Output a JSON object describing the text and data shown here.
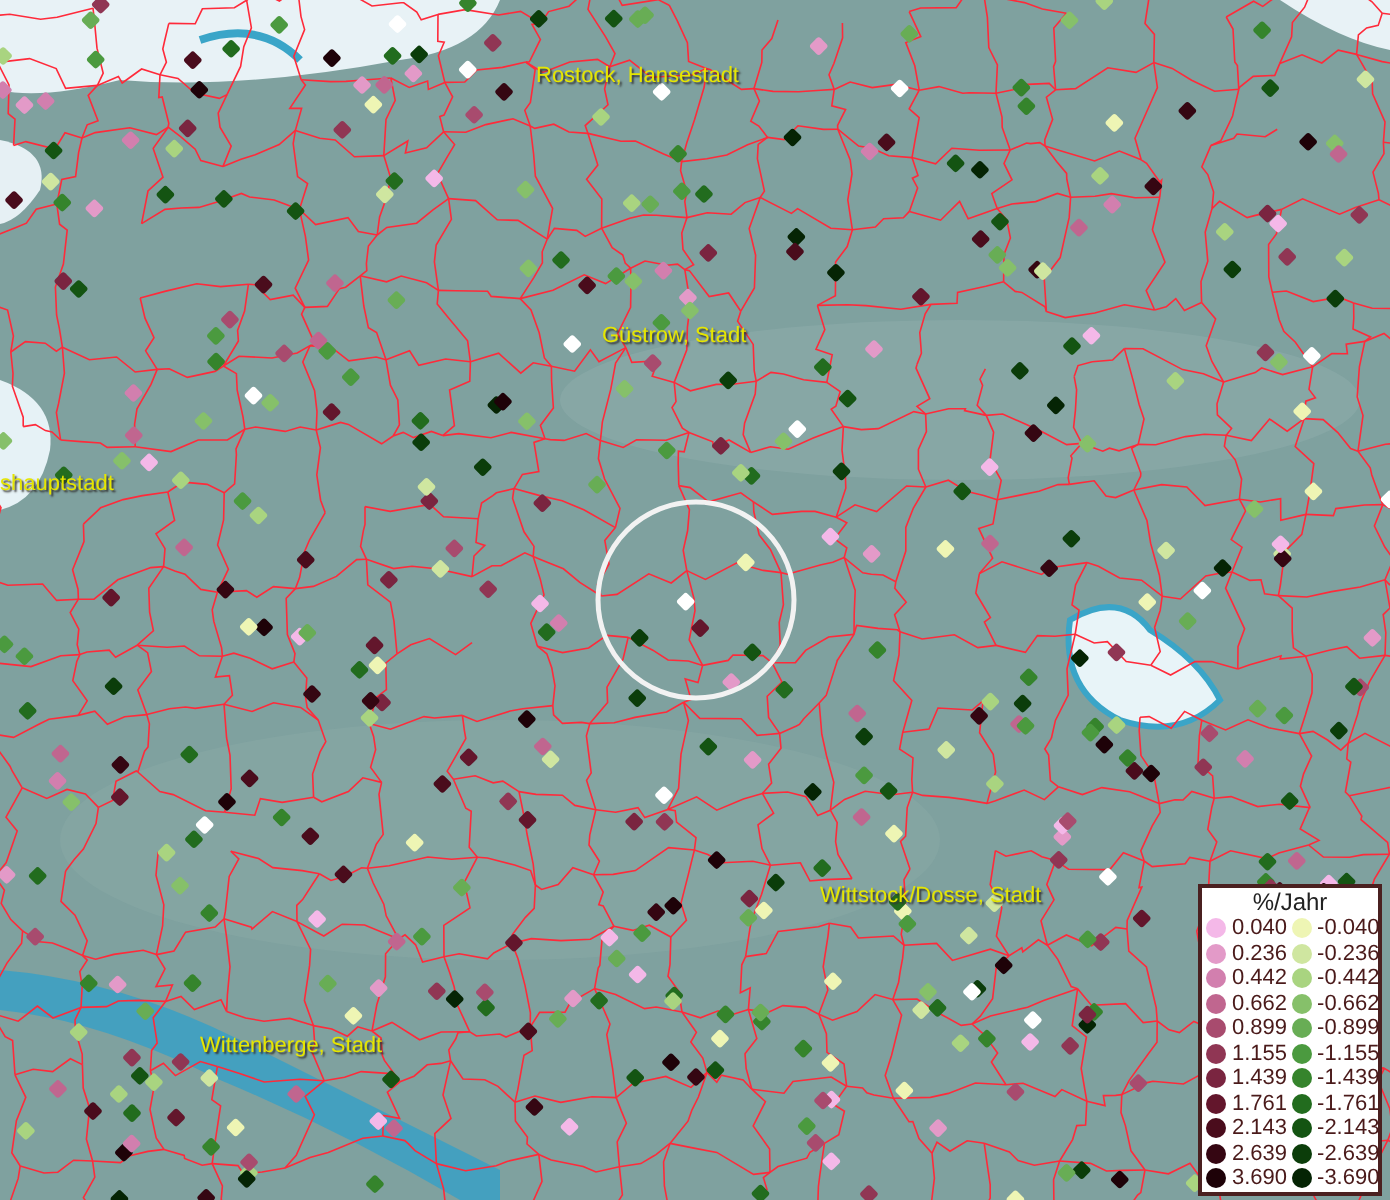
{
  "map": {
    "places": [
      {
        "name": "Rostock, Hansestadt"
      },
      {
        "name": "Güstrow, Stadt"
      },
      {
        "name": "shauptstadt"
      },
      {
        "name": "Wittstock/Dosse, Stadt"
      },
      {
        "name": "Wittenberge, Stadt"
      }
    ]
  },
  "legend": {
    "title": "%/Jahr",
    "entries": [
      {
        "label": "0.040",
        "color": "#f4b8e8"
      },
      {
        "label": "-0.040",
        "color": "#eef5b4"
      },
      {
        "label": "0.236",
        "color": "#e39ac8"
      },
      {
        "label": "-0.236",
        "color": "#cfe6a0"
      },
      {
        "label": "0.442",
        "color": "#d27fae"
      },
      {
        "label": "-0.442",
        "color": "#a9d480"
      },
      {
        "label": "0.662",
        "color": "#c0668f"
      },
      {
        "label": "-0.662",
        "color": "#86c06a"
      },
      {
        "label": "0.899",
        "color": "#a84b6e"
      },
      {
        "label": "-0.899",
        "color": "#68ad55"
      },
      {
        "label": "1.155",
        "color": "#903654"
      },
      {
        "label": "-1.155",
        "color": "#4b9a3f"
      },
      {
        "label": "1.439",
        "color": "#7a2540"
      },
      {
        "label": "-1.439",
        "color": "#35842c"
      },
      {
        "label": "1.761",
        "color": "#63162c"
      },
      {
        "label": "-1.761",
        "color": "#226c1e"
      },
      {
        "label": "2.143",
        "color": "#4a0c1c"
      },
      {
        "label": "-2.143",
        "color": "#145412"
      },
      {
        "label": "2.639",
        "color": "#350612"
      },
      {
        "label": "-2.639",
        "color": "#0b3d0a"
      },
      {
        "label": "3.690",
        "color": "#1e0208"
      },
      {
        "label": "-3.690",
        "color": "#052404"
      }
    ]
  }
}
